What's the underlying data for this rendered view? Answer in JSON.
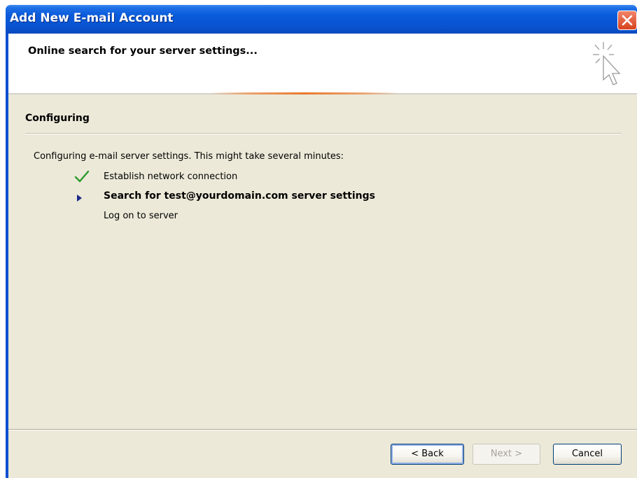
{
  "window": {
    "title": "Add New E-mail Account"
  },
  "header": {
    "title": "Online search for your server settings..."
  },
  "section": {
    "title": "Configuring",
    "intro": "Configuring e-mail server settings. This might take several minutes:"
  },
  "steps": [
    {
      "label": "Establish network connection",
      "status": "done",
      "icon": "checkmark-icon"
    },
    {
      "label": "Search for test@yourdomain.com server settings",
      "status": "current",
      "icon": "arrow-right-icon"
    },
    {
      "label": "Log on to server",
      "status": "pending",
      "icon": ""
    }
  ],
  "buttons": {
    "back": "< Back",
    "next": "Next >",
    "cancel": "Cancel"
  },
  "colors": {
    "titlebar": "#0a5cdb",
    "dialog_bg": "#ece9d8",
    "check": "#2c9a2c",
    "arrow": "#1c2a8a",
    "close": "#d8421e"
  }
}
